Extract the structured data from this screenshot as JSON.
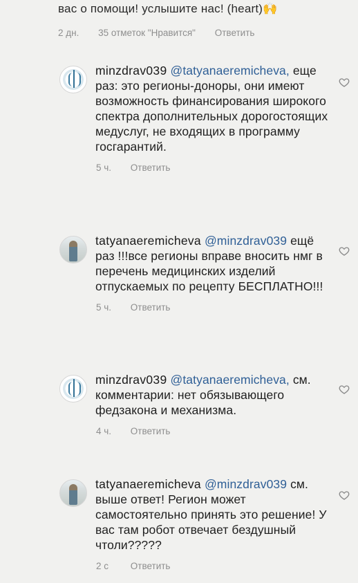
{
  "top": {
    "text": "вас о помощи! услышите нас! (heart)",
    "emoji": "🙌",
    "time": "2 дн.",
    "likes": "35 отметок \"Нравится\"",
    "reply": "Ответить"
  },
  "comments": [
    {
      "username": "minzdrav039",
      "mention": "@tatyanaeremicheva,",
      "text": "еще раз: это регионы-доноры, они имеют возможность финансирования широкого спектра дополнительных дорогостоящих медуслуг, не входящих в программу госгарантий.",
      "time": "5 ч.",
      "reply": "Ответить",
      "avatar": "ministry-emblem"
    },
    {
      "username": "tatyanaeremicheva",
      "mention": "@minzdrav039",
      "text": "ещё раз !!!все регионы вправе вносить нмг в перечень медицинских изделий отпускаемых по рецепту БЕСПЛАТНО!!!",
      "time": "5 ч.",
      "reply": "Ответить",
      "avatar": "user-photo"
    },
    {
      "username": "minzdrav039",
      "mention": "@tatyanaeremicheva,",
      "text": "см. комментарии: нет обязывающего федзакона и механизма.",
      "time": "4 ч.",
      "reply": "Ответить",
      "avatar": "ministry-emblem"
    },
    {
      "username": "tatyanaeremicheva",
      "mention": "@minzdrav039",
      "text": "см. выше ответ! Регион может самостоятельно принять это решение! У вас там робот отвечает бездушный чтоли?????",
      "time": "2 с",
      "reply": "Ответить",
      "avatar": "user-photo"
    }
  ],
  "icons": {
    "like": "heart-outline-icon"
  }
}
